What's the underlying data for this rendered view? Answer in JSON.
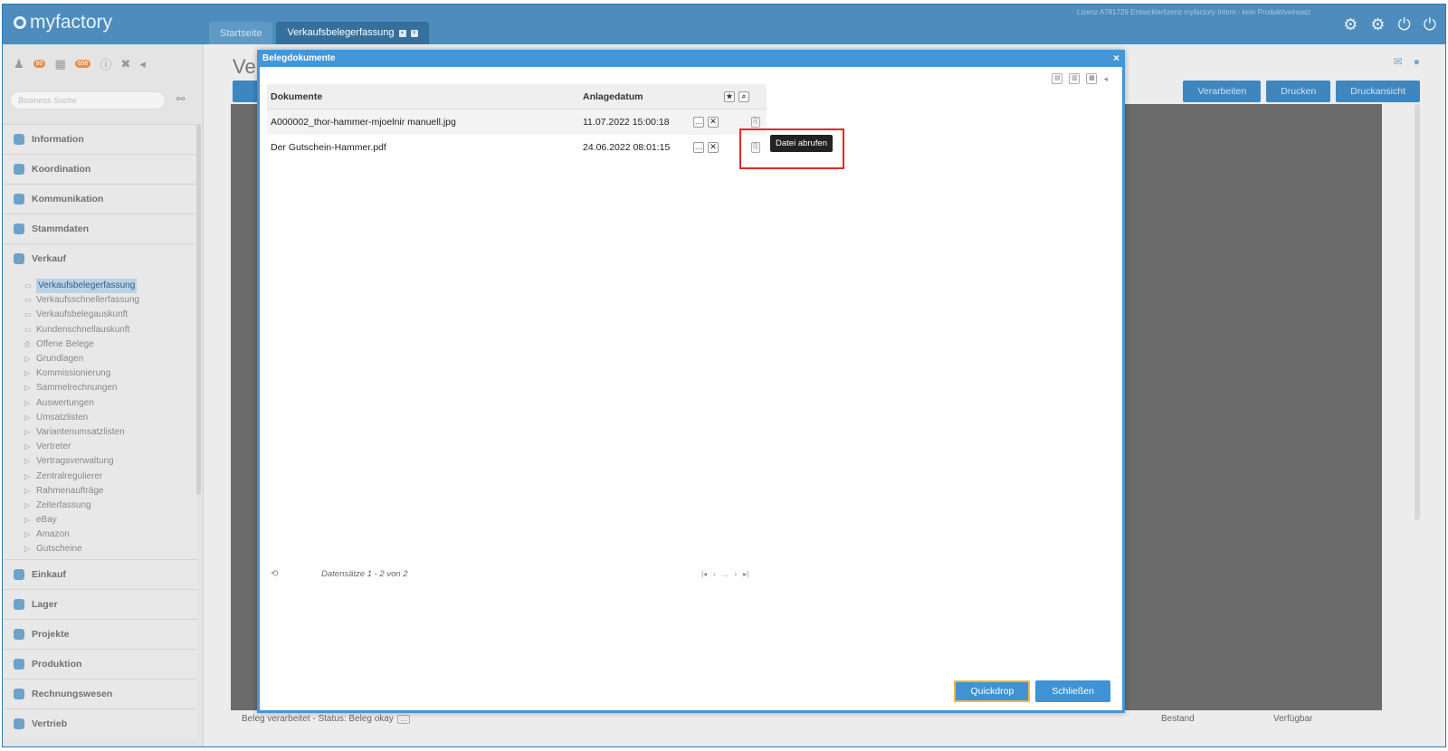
{
  "app": {
    "logo": "myfactory",
    "license": "Lizenz A781729 Entwicklerlizenz myfactory Intern - kein Produktiveinsatz",
    "tabs": [
      {
        "label": "Startseite"
      },
      {
        "label": "Verkaufsbelegerfassung"
      }
    ]
  },
  "toolbar": {
    "badge1": "80",
    "badge2": "656"
  },
  "sidebar": {
    "search_placeholder": "Business Suche",
    "sections_top": [
      {
        "label": "Information"
      },
      {
        "label": "Koordination"
      },
      {
        "label": "Kommunikation"
      },
      {
        "label": "Stammdaten"
      },
      {
        "label": "Verkauf"
      }
    ],
    "verkauf_items": [
      {
        "label": "Verkaufsbelegerfassung"
      },
      {
        "label": "Verkaufsschnellerfassung"
      },
      {
        "label": "Verkaufsbelegauskunft"
      },
      {
        "label": "Kundenschnellauskunft"
      },
      {
        "label": "Offene Belege"
      },
      {
        "label": "Grundlagen"
      },
      {
        "label": "Kommissionierung"
      },
      {
        "label": "Sammelrechnungen"
      },
      {
        "label": "Auswertungen"
      },
      {
        "label": "Umsatzlisten"
      },
      {
        "label": "Variantenumsatzlisten"
      },
      {
        "label": "Vertreter"
      },
      {
        "label": "Vertragsverwaltung"
      },
      {
        "label": "Zentralregulierer"
      },
      {
        "label": "Rahmenaufträge"
      },
      {
        "label": "Zeiterfassung"
      },
      {
        "label": "eBay"
      },
      {
        "label": "Amazon"
      },
      {
        "label": "Gutscheine"
      }
    ],
    "sections_bottom": [
      {
        "label": "Einkauf"
      },
      {
        "label": "Lager"
      },
      {
        "label": "Projekte"
      },
      {
        "label": "Produktion"
      },
      {
        "label": "Rechnungswesen"
      },
      {
        "label": "Vertrieb"
      }
    ]
  },
  "main": {
    "title": "Ver",
    "buttons": {
      "process": "Verarbeiten",
      "print": "Drucken",
      "preview": "Druckansicht"
    },
    "status": "Beleg verarbeitet - Status: Beleg okay",
    "col_bestand": "Bestand",
    "col_verfuegbar": "Verfügbar"
  },
  "dialog": {
    "title": "Belegdokumente",
    "columns": {
      "documents": "Dokumente",
      "created": "Anlagedatum"
    },
    "rows": [
      {
        "document": "A000002_thor-hammer-mjoelnir manuell.jpg",
        "created": "11.07.2022 15:00:18"
      },
      {
        "document": "Der Gutschein-Hammer.pdf",
        "created": "24.06.2022 08:01:15"
      }
    ],
    "tooltip": "Datei abrufen",
    "pager_text": "Datensätze 1 - 2 von 2",
    "pager_dots": "...",
    "buttons": {
      "quickdrop": "Quickdrop",
      "close": "Schließen"
    }
  },
  "colors": {
    "header": "#4d8cbd",
    "dialog_accent": "#4596d6",
    "highlight": "#e02a2a"
  }
}
